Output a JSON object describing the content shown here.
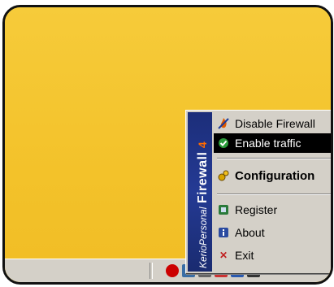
{
  "menu": {
    "banner": {
      "brand": "KerioPersonal",
      "product": "Firewall",
      "version": "4"
    },
    "items": [
      {
        "label": "Disable Firewall",
        "icon": "flame-no-icon"
      },
      {
        "label": "Enable traffic",
        "icon": "check-icon"
      },
      {
        "label": "Configuration",
        "icon": "gears-icon"
      },
      {
        "label": "Register",
        "icon": "register-icon"
      },
      {
        "label": "About",
        "icon": "about-icon"
      },
      {
        "label": "Exit",
        "icon": "close-icon"
      }
    ]
  },
  "colors": {
    "desktop": "#f3c22a",
    "banner": "#243a94",
    "highlight": "#000000"
  }
}
